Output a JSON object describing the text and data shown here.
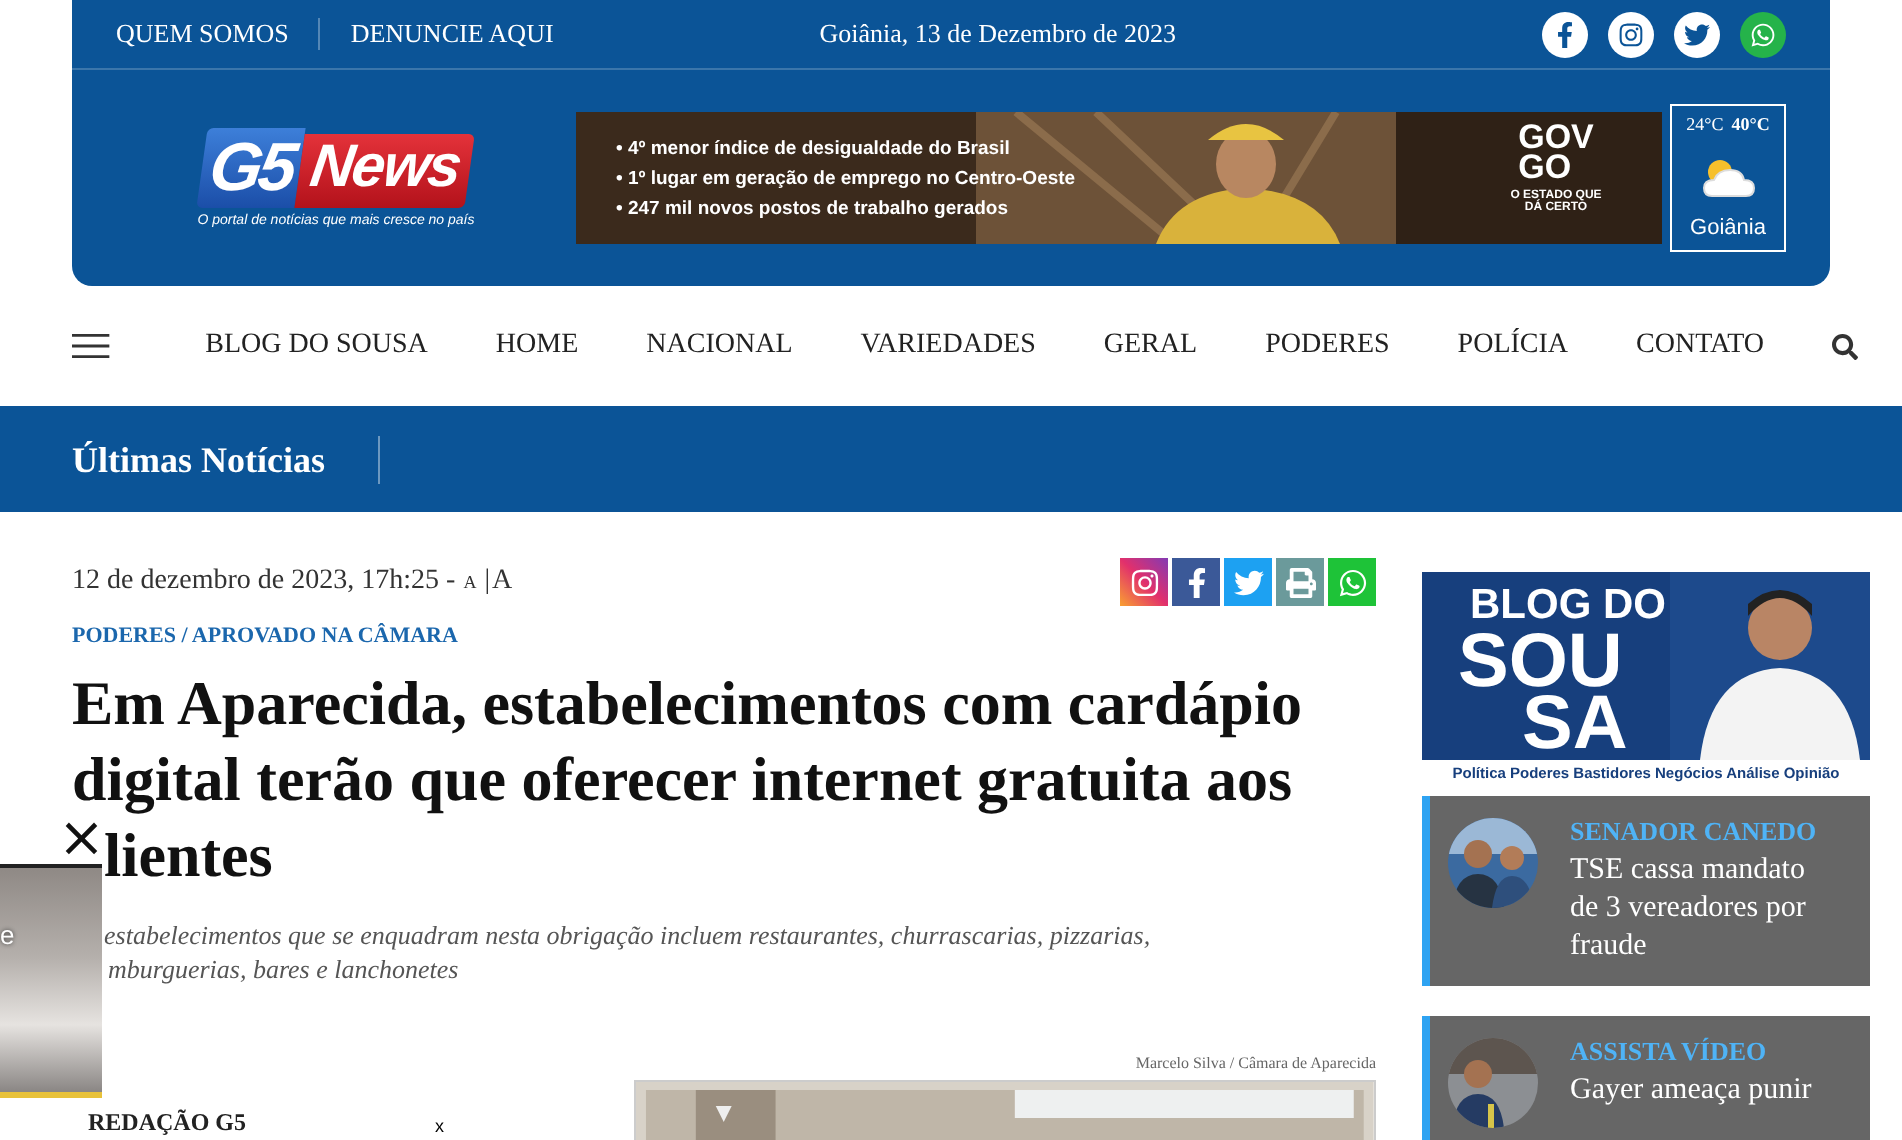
{
  "topbar": {
    "links": [
      "QUEM SOMOS",
      "DENUNCIE AQUI"
    ],
    "date": "Goiânia, 13 de Dezembro de 2023",
    "social": [
      {
        "kind": "facebook"
      },
      {
        "kind": "instagram"
      },
      {
        "kind": "twitter"
      },
      {
        "kind": "whatsapp"
      }
    ]
  },
  "logo": {
    "brand_a": "G5",
    "brand_b": "News",
    "tagline": "O portal de notícias que mais cresce no país"
  },
  "ad_banner": {
    "bullets": [
      "• 4º menor índice de desigualdade do Brasil",
      "• 1º lugar em geração de emprego no Centro-Oeste",
      "• 247 mil novos postos de trabalho gerados"
    ],
    "brand_a": "GOV",
    "brand_b": "GO",
    "slogan": "O ESTADO QUE DÁ CERTO"
  },
  "weather": {
    "min": "24°C",
    "max": "40°C",
    "city": "Goiânia"
  },
  "nav": {
    "items": [
      "BLOG DO SOUSA",
      "HOME",
      "NACIONAL",
      "VARIEDADES",
      "GERAL",
      "PODERES",
      "POLÍCIA",
      "CONTATO"
    ]
  },
  "ticker": {
    "title": "Últimas Notícias"
  },
  "article": {
    "meta": "12 de dezembro de 2023, 17h:25 -",
    "font_small": "A",
    "font_sep": "|",
    "font_large": "A",
    "share": [
      {
        "kind": "instagram"
      },
      {
        "kind": "facebook"
      },
      {
        "kind": "twitter"
      },
      {
        "kind": "print"
      },
      {
        "kind": "whatsapp"
      }
    ],
    "category": "PODERES / APROVADO NA CÂMARA",
    "headline_lines": [
      "Em Aparecida, estabelecimentos com cardápio",
      "digital terão que oferecer internet gratuita aos",
      "lientes"
    ],
    "subtitle_lines": [
      "estabelecimentos que se enquadram nesta obrigação incluem restaurantes, churrascarias, pizzarias,",
      "mburguerias, bares e lanchonetes"
    ],
    "photo_credit": "Marcelo Silva / Câmara de Aparecida",
    "author": "REDAÇÃO G5",
    "mark": "x"
  },
  "sidebar": {
    "banner": {
      "title_a": "BLOG DO",
      "title_b": "SOU",
      "title_c": "SA",
      "tags": "Política Poderes Bastidores Negócios Análise Opinião"
    },
    "cards": [
      {
        "category": "SENADOR CANEDO",
        "title": "TSE cassa mandato de 3 vereadores por fraude"
      },
      {
        "category": "ASSISTA VÍDEO",
        "title": "Gayer ameaça punir"
      }
    ]
  },
  "overlay": {
    "close": "×",
    "text": "e"
  }
}
